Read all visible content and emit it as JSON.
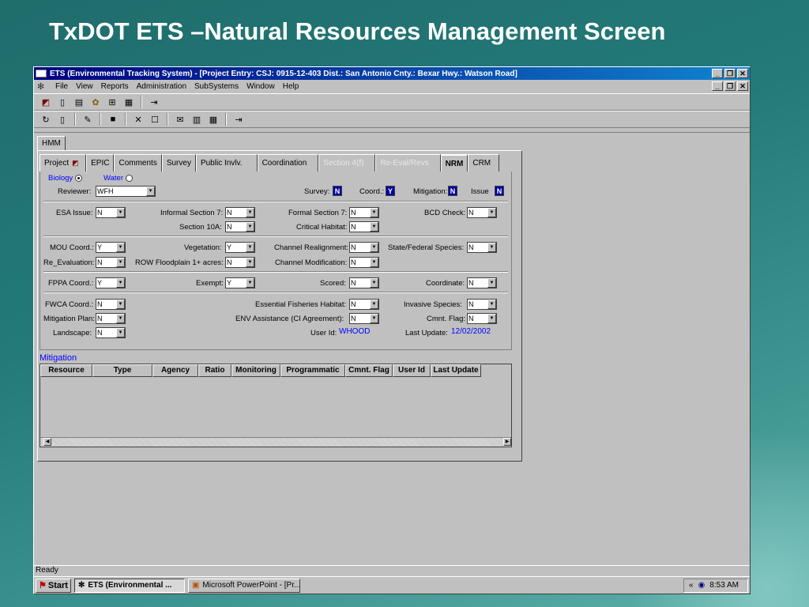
{
  "slide": {
    "title": "TxDOT ETS –Natural Resources Management Screen"
  },
  "window": {
    "title": "ETS (Environmental Tracking System) - [Project Entry:  CSJ: 0915-12-403   Dist.: San Antonio   Cnty.: Bexar   Hwy.: Watson Road]",
    "controls": {
      "minimize": "_",
      "restore": "❐",
      "close": "✕"
    }
  },
  "menu": [
    "File",
    "View",
    "Reports",
    "Administration",
    "SubSystems",
    "Window",
    "Help"
  ],
  "outer_tab": "HMM",
  "tabs": [
    {
      "label": "Project",
      "state": "normal"
    },
    {
      "label": "EPIC",
      "state": "normal"
    },
    {
      "label": "Comments",
      "state": "normal"
    },
    {
      "label": "Survey",
      "state": "normal"
    },
    {
      "label": "Public Invlv.",
      "state": "normal"
    },
    {
      "label": "Coordination",
      "state": "normal"
    },
    {
      "label": "Section 4(f)",
      "state": "disabled"
    },
    {
      "label": "Re-Eval/Revs",
      "state": "disabled"
    },
    {
      "label": "NRM",
      "state": "active"
    },
    {
      "label": "CRM",
      "state": "normal"
    }
  ],
  "form": {
    "biology_label": "Biology",
    "water_label": "Water",
    "reviewer_label": "Reviewer:",
    "reviewer_value": "WFH",
    "survey_label": "Survey:",
    "survey_value": "N",
    "coord_label": "Coord.:",
    "coord_value": "Y",
    "mitigation_label": "Mitigation:",
    "mitigation_value": "N",
    "issue_label": "Issue",
    "issue_value": "N",
    "esa_issue_label": "ESA Issue:",
    "esa_issue_value": "N",
    "informal_s7_label": "Informal Section 7:",
    "informal_s7_value": "N",
    "formal_s7_label": "Formal Section 7:",
    "formal_s7_value": "N",
    "bcd_check_label": "BCD Check:",
    "bcd_check_value": "N",
    "section_10a_label": "Section 10A:",
    "section_10a_value": "N",
    "critical_habitat_label": "Critical Habitat:",
    "critical_habitat_value": "N",
    "mou_coord_label": "MOU Coord.:",
    "mou_coord_value": "Y",
    "vegetation_label": "Vegetation:",
    "vegetation_value": "Y",
    "channel_realign_label": "Channel Realignment:",
    "channel_realign_value": "N",
    "state_fed_species_label": "State/Federal Species:",
    "state_fed_species_value": "N",
    "re_eval_label": "Re_Evaluation:",
    "re_eval_value": "N",
    "row_floodplain_label": "ROW Floodplain 1+ acres:",
    "row_floodplain_value": "N",
    "channel_mod_label": "Channel Modification:",
    "channel_mod_value": "N",
    "fppa_coord_label": "FPPA Coord.:",
    "fppa_coord_value": "Y",
    "exempt_label": "Exempt:",
    "exempt_value": "Y",
    "scored_label": "Scored:",
    "scored_value": "N",
    "coordinate_label": "Coordinate:",
    "coordinate_value": "N",
    "fwca_coord_label": "FWCA Coord.:",
    "fwca_coord_value": "N",
    "essential_fish_label": "Essential Fisheries Habitat:",
    "essential_fish_value": "N",
    "invasive_species_label": "Invasive Species:",
    "invasive_species_value": "N",
    "mitigation_plan_label": "Mitigation Plan:",
    "mitigation_plan_value": "N",
    "env_assistance_label": "ENV Assistance (CI Agreement):",
    "env_assistance_value": "N",
    "cmnt_flag_label": "Cmnt. Flag:",
    "cmnt_flag_value": "N",
    "landscape_label": "Landscape:",
    "landscape_value": "N",
    "user_id_label": "User Id:",
    "user_id_value": "WHOOD",
    "last_update_label": "Last Update:",
    "last_update_value": "12/02/2002"
  },
  "mitigation": {
    "title": "Mitigation",
    "columns": [
      "Resource",
      "Type",
      "Agency",
      "Ratio",
      "Monitoring",
      "Programmatic",
      "Cmnt. Flag",
      "User Id",
      "Last Update"
    ]
  },
  "status": "Ready",
  "taskbar": {
    "start": "Start",
    "items": [
      "ETS (Environmental ...",
      "Microsoft PowerPoint - [Pr..."
    ],
    "time": "8:53 AM"
  }
}
